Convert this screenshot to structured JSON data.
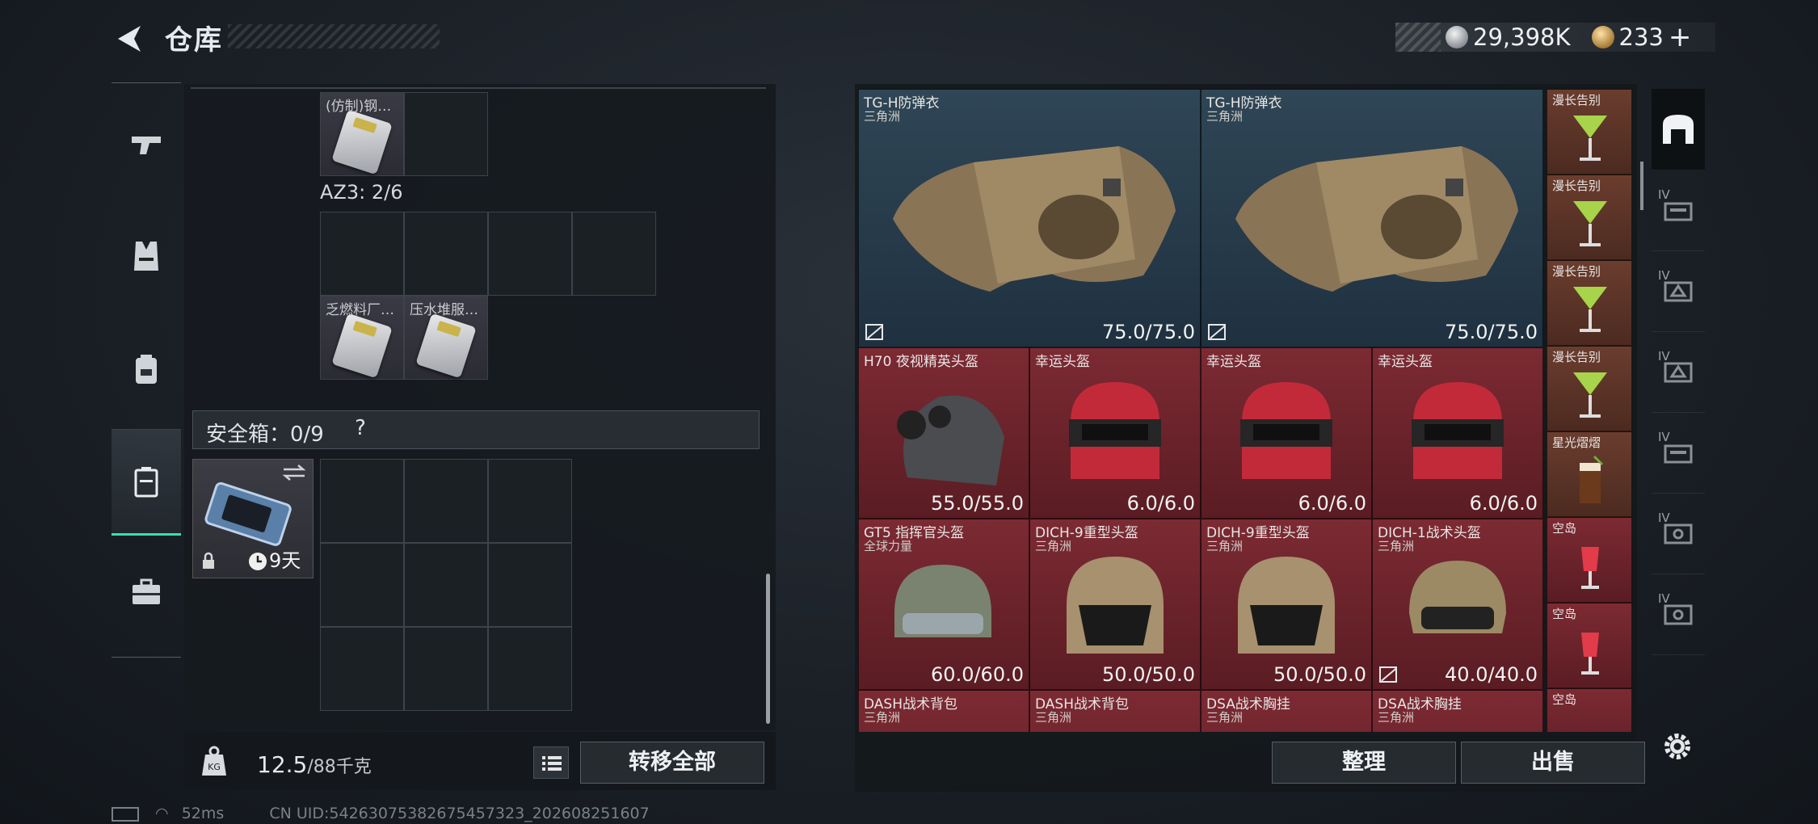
{
  "header": {
    "title": "仓库"
  },
  "currency": {
    "silver": "29,398K",
    "gold": "233",
    "plus": "+"
  },
  "left_rail": {
    "items": [
      "weapon",
      "vest",
      "backpack",
      "safe-case",
      "toolbox"
    ]
  },
  "container": {
    "top_item_label": "(仿制)钢…",
    "az3_label": "AZ3: 2/6",
    "item1_label": "乏燃料厂…",
    "item2_label": "压水堆服…"
  },
  "safe": {
    "title": "安全箱：0/9",
    "help": "?",
    "timer": "9天"
  },
  "weight": {
    "current": "12.5",
    "unit": "/88千克"
  },
  "buttons": {
    "transfer_all": "转移全部",
    "sort": "整理",
    "sell": "出售"
  },
  "inventory": {
    "large": [
      {
        "name": "TG-H防弹衣",
        "sub": "三角洲",
        "durability": "75.0/75.0"
      },
      {
        "name": "TG-H防弹衣",
        "sub": "三角洲",
        "durability": "75.0/75.0"
      }
    ],
    "row2": [
      {
        "name": "H70 夜视精英头盔",
        "sub": "",
        "durability": "55.0/55.0"
      },
      {
        "name": "幸运头盔",
        "sub": "",
        "durability": "6.0/6.0"
      },
      {
        "name": "幸运头盔",
        "sub": "",
        "durability": "6.0/6.0"
      },
      {
        "name": "幸运头盔",
        "sub": "",
        "durability": "6.0/6.0"
      }
    ],
    "row3": [
      {
        "name": "GT5 指挥官头盔",
        "sub": "全球力量",
        "durability": "60.0/60.0"
      },
      {
        "name": "DICH-9重型头盔",
        "sub": "三角洲",
        "durability": "50.0/50.0"
      },
      {
        "name": "DICH-9重型头盔",
        "sub": "三角洲",
        "durability": "50.0/50.0"
      },
      {
        "name": "DICH-1战术头盔",
        "sub": "三角洲",
        "durability": "40.0/40.0"
      }
    ],
    "row4": [
      {
        "name": "DASH战术背包",
        "sub": "三角洲"
      },
      {
        "name": "DASH战术背包",
        "sub": "三角洲"
      },
      {
        "name": "DSA战术胸挂",
        "sub": "三角洲"
      },
      {
        "name": "DSA战术胸挂",
        "sub": "三角洲"
      }
    ],
    "side_items": [
      "漫长告别",
      "漫长告别",
      "漫长告别",
      "漫长告别",
      "星光熠熠",
      "空岛",
      "空岛",
      "空岛"
    ]
  },
  "right_rail": {
    "labels": [
      "IV",
      "IV",
      "IV",
      "IV",
      "IV",
      "IV"
    ]
  },
  "status": {
    "ping": "52ms",
    "uid": "CN UID:54263075382675457323_202608251607"
  },
  "colors": {
    "accent": "#37e0b0",
    "red_slot": "#7c2a33",
    "blue_slot": "#2f4656",
    "brown_slot": "#6a3d2e"
  }
}
